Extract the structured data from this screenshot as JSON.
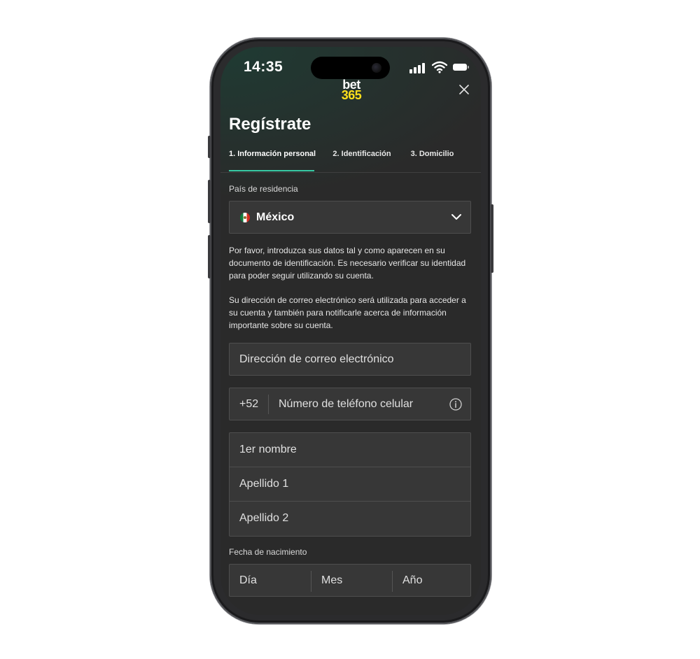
{
  "status_bar": {
    "time": "14:35"
  },
  "brand": {
    "line1": "bet",
    "line2": "365",
    "accent_color": "#ffdf1b"
  },
  "header": {
    "title": "Regístrate",
    "close_icon": "close-icon"
  },
  "tabs": [
    {
      "label": "1.  Información personal",
      "active": true
    },
    {
      "label": "2.  Identificación",
      "active": false
    },
    {
      "label": "3.  Domicilio",
      "active": false
    }
  ],
  "country": {
    "label": "País de residencia",
    "value": "México",
    "flag_icon": "mexico-flag-icon",
    "dropdown_icon": "chevron-down-icon"
  },
  "info_text": {
    "p1": "Por favor, introduzca sus datos tal y como aparecen en su documento de identificación. Es necesario verificar su identidad para poder seguir utilizando su cuenta.",
    "p2": "Su dirección de correo electrónico será utilizada para acceder a su cuenta y también para notificarle acerca de información importante sobre su cuenta."
  },
  "form": {
    "email_placeholder": "Dirección de correo electrónico",
    "phone_code": "+52",
    "phone_placeholder": "Número de teléfono celular",
    "first_name_placeholder": "1er nombre",
    "last_name1_placeholder": "Apellido 1",
    "last_name2_placeholder": "Apellido 2",
    "dob_label": "Fecha de nacimiento",
    "dob_day": "Día",
    "dob_month": "Mes",
    "dob_year": "Año"
  },
  "colors": {
    "tab_active_underline": "#37c9a4",
    "background": "#2a2a2a",
    "field": "#373737"
  }
}
